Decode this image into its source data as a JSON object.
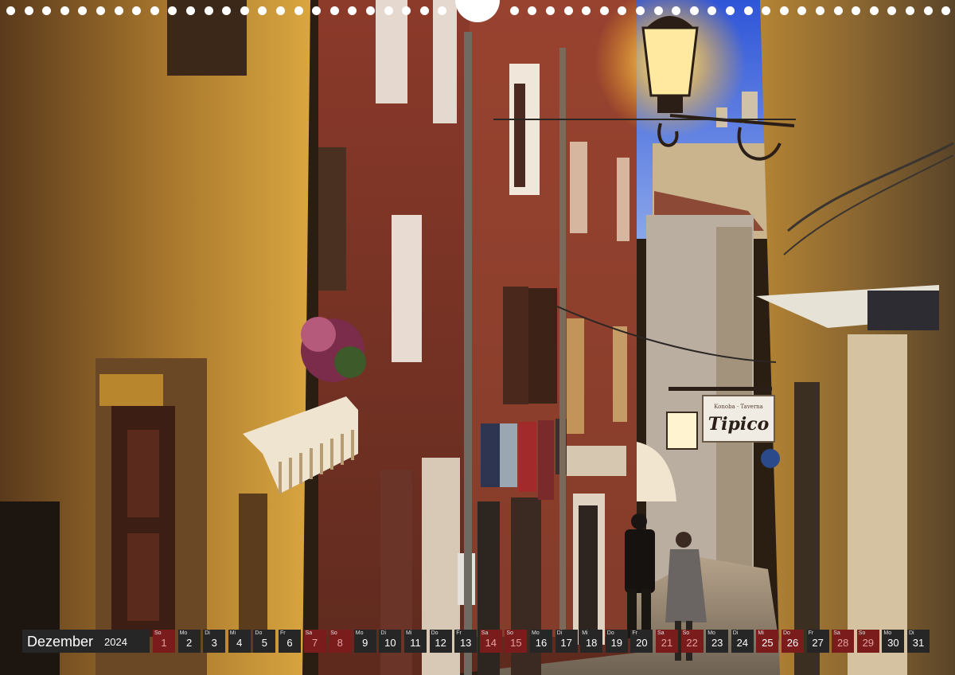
{
  "calendar": {
    "month": "Dezember",
    "year": "2024",
    "days": [
      {
        "wd": "So",
        "d": "1",
        "type": "weekend"
      },
      {
        "wd": "Mo",
        "d": "2",
        "type": "normal"
      },
      {
        "wd": "Di",
        "d": "3",
        "type": "normal"
      },
      {
        "wd": "Mi",
        "d": "4",
        "type": "normal"
      },
      {
        "wd": "Do",
        "d": "5",
        "type": "normal"
      },
      {
        "wd": "Fr",
        "d": "6",
        "type": "normal"
      },
      {
        "wd": "Sa",
        "d": "7",
        "type": "weekend"
      },
      {
        "wd": "So",
        "d": "8",
        "type": "weekend"
      },
      {
        "wd": "Mo",
        "d": "9",
        "type": "normal"
      },
      {
        "wd": "Di",
        "d": "10",
        "type": "normal"
      },
      {
        "wd": "Mi",
        "d": "11",
        "type": "normal"
      },
      {
        "wd": "Do",
        "d": "12",
        "type": "normal"
      },
      {
        "wd": "Fr",
        "d": "13",
        "type": "normal"
      },
      {
        "wd": "Sa",
        "d": "14",
        "type": "weekend"
      },
      {
        "wd": "So",
        "d": "15",
        "type": "weekend"
      },
      {
        "wd": "Mo",
        "d": "16",
        "type": "normal"
      },
      {
        "wd": "Di",
        "d": "17",
        "type": "normal"
      },
      {
        "wd": "Mi",
        "d": "18",
        "type": "normal"
      },
      {
        "wd": "Do",
        "d": "19",
        "type": "normal"
      },
      {
        "wd": "Fr",
        "d": "20",
        "type": "normal"
      },
      {
        "wd": "Sa",
        "d": "21",
        "type": "weekend"
      },
      {
        "wd": "So",
        "d": "22",
        "type": "weekend"
      },
      {
        "wd": "Mo",
        "d": "23",
        "type": "normal"
      },
      {
        "wd": "Di",
        "d": "24",
        "type": "normal"
      },
      {
        "wd": "Mi",
        "d": "25",
        "type": "holiday"
      },
      {
        "wd": "Do",
        "d": "26",
        "type": "holiday"
      },
      {
        "wd": "Fr",
        "d": "27",
        "type": "normal"
      },
      {
        "wd": "Sa",
        "d": "28",
        "type": "weekend"
      },
      {
        "wd": "So",
        "d": "29",
        "type": "weekend"
      },
      {
        "wd": "Mo",
        "d": "30",
        "type": "normal"
      },
      {
        "wd": "Di",
        "d": "31",
        "type": "normal"
      }
    ]
  },
  "scene": {
    "shop_sign_small": "Konoba · Taverna",
    "shop_sign_main": "Tipico"
  },
  "colors": {
    "cal_cell": "#262626",
    "weekend_cell": "#7a1c1c",
    "sky": "#3a5fd6",
    "lamp_glow": "#ffd36a"
  }
}
